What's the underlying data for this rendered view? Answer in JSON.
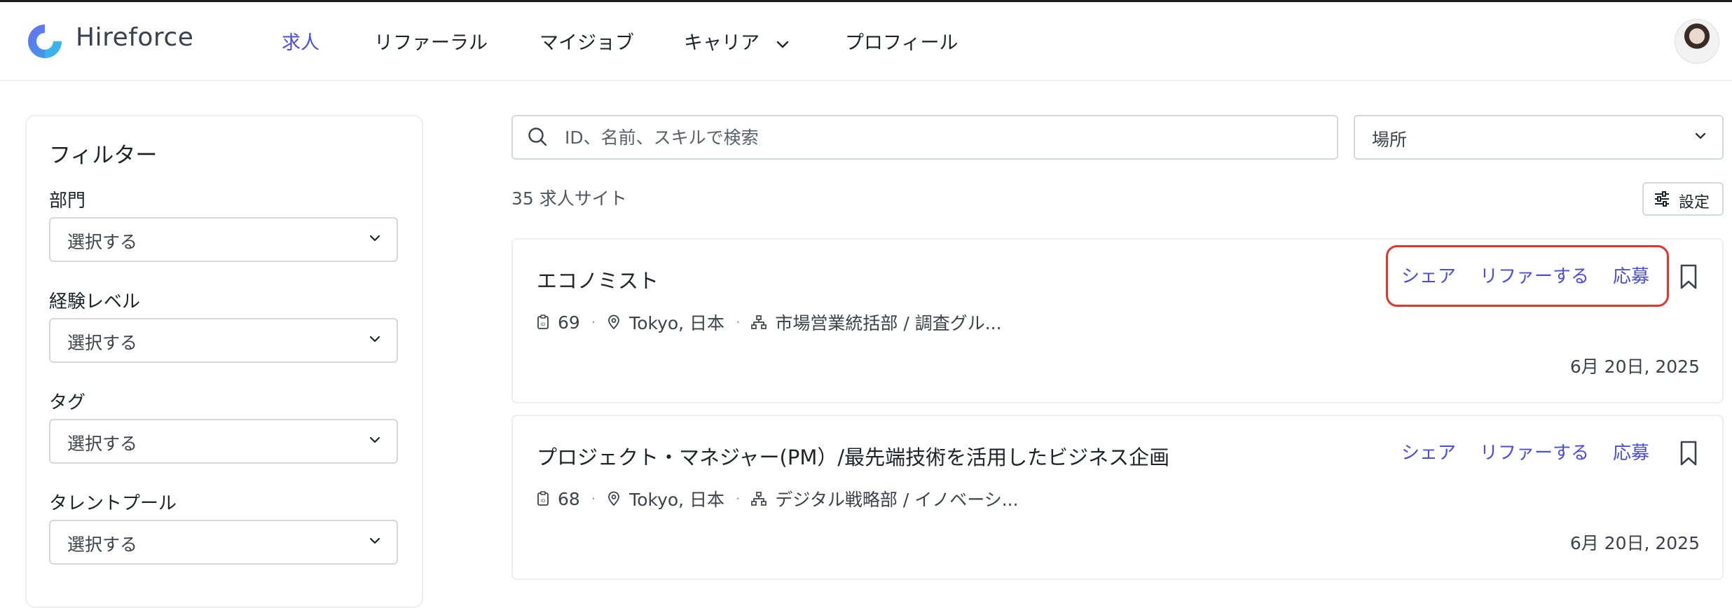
{
  "header": {
    "brand": "Hireforce",
    "nav": [
      {
        "label": "求人",
        "active": true
      },
      {
        "label": "リファーラル"
      },
      {
        "label": "マイジョブ"
      },
      {
        "label": "キャリア"
      },
      {
        "label": "プロフィール"
      }
    ]
  },
  "sidebar": {
    "title": "フィルター",
    "filters": [
      {
        "label": "部門",
        "value": "選択する"
      },
      {
        "label": "経験レベル",
        "value": "選択する"
      },
      {
        "label": "タグ",
        "value": "選択する"
      },
      {
        "label": "タレントプール",
        "value": "選択する"
      }
    ]
  },
  "search": {
    "placeholder": "ID、名前、スキルで検索",
    "value": ""
  },
  "location": {
    "value": "場所"
  },
  "results": {
    "count_text": "35 求人サイト"
  },
  "settings_label": "設定",
  "jobs": [
    {
      "title": "エコノミスト",
      "id": "69",
      "location": "Tokyo, 日本",
      "department": "市場営業統括部 / 調査グル...",
      "date": "6月 20日, 2025",
      "actions": {
        "share": "シェア",
        "refer": "リファーする",
        "apply": "応募"
      }
    },
    {
      "title": "プロジェクト・マネジャー(PM）/最先端技術を活用したビジネス企画",
      "id": "68",
      "location": "Tokyo, 日本",
      "department": "デジタル戦略部 / イノベーシ...",
      "date": "6月 20日, 2025",
      "actions": {
        "share": "シェア",
        "refer": "リファーする",
        "apply": "応募"
      }
    }
  ],
  "colors": {
    "accent": "#4a4de0",
    "highlight": "#e0362c",
    "border": "#d4d7dd"
  }
}
